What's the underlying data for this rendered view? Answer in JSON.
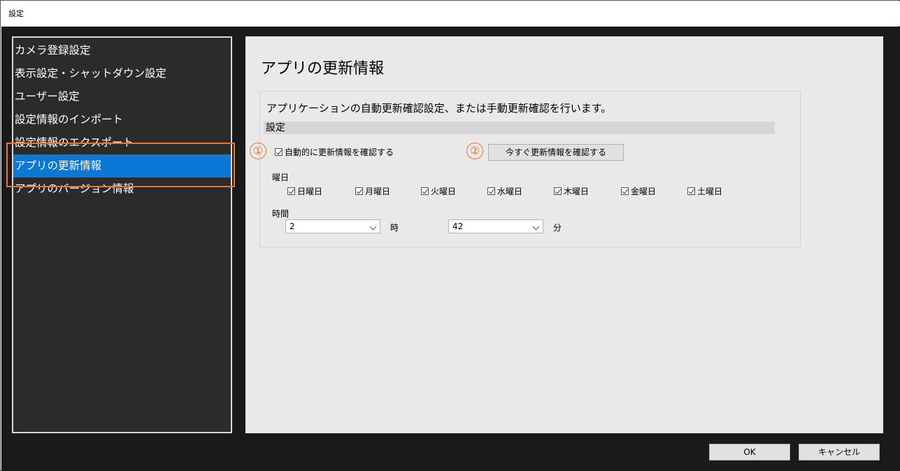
{
  "window": {
    "title": "設定"
  },
  "sidebar": {
    "items": [
      {
        "label": "カメラ登録設定"
      },
      {
        "label": "表示設定・シャットダウン設定"
      },
      {
        "label": "ユーザー設定"
      },
      {
        "label": "設定情報のインポート"
      },
      {
        "label": "設定情報のエクスポート"
      },
      {
        "label": "アプリの更新情報",
        "active": true
      },
      {
        "label": "アプリのバージョン情報"
      }
    ]
  },
  "main": {
    "title": "アプリの更新情報",
    "description": "アプリケーションの自動更新確認設定、または手動更新確認を行います。",
    "section_label": "設定",
    "auto_check": {
      "label": "自動的に更新情報を確認する",
      "checked": true
    },
    "check_now_button": "今すぐ更新情報を確認する",
    "markers": [
      "①",
      "②"
    ],
    "days_label": "曜日",
    "days": [
      {
        "label": "日曜日",
        "checked": true
      },
      {
        "label": "月曜日",
        "checked": true
      },
      {
        "label": "火曜日",
        "checked": true
      },
      {
        "label": "水曜日",
        "checked": true
      },
      {
        "label": "木曜日",
        "checked": true
      },
      {
        "label": "金曜日",
        "checked": true
      },
      {
        "label": "土曜日",
        "checked": true
      }
    ],
    "time_label": "時間",
    "hour": {
      "value": "2",
      "unit": "時"
    },
    "minute": {
      "value": "42",
      "unit": "分"
    }
  },
  "footer": {
    "ok_label": "OK",
    "cancel_label": "キャンセル"
  },
  "colors": {
    "accent": "#0a78d4",
    "highlight": "#e8762c",
    "sidebar_bg": "#2b2b2b",
    "content_bg": "#e9e9e9"
  },
  "icons": [
    "checkbox-checked-icon",
    "chevron-down-icon"
  ]
}
